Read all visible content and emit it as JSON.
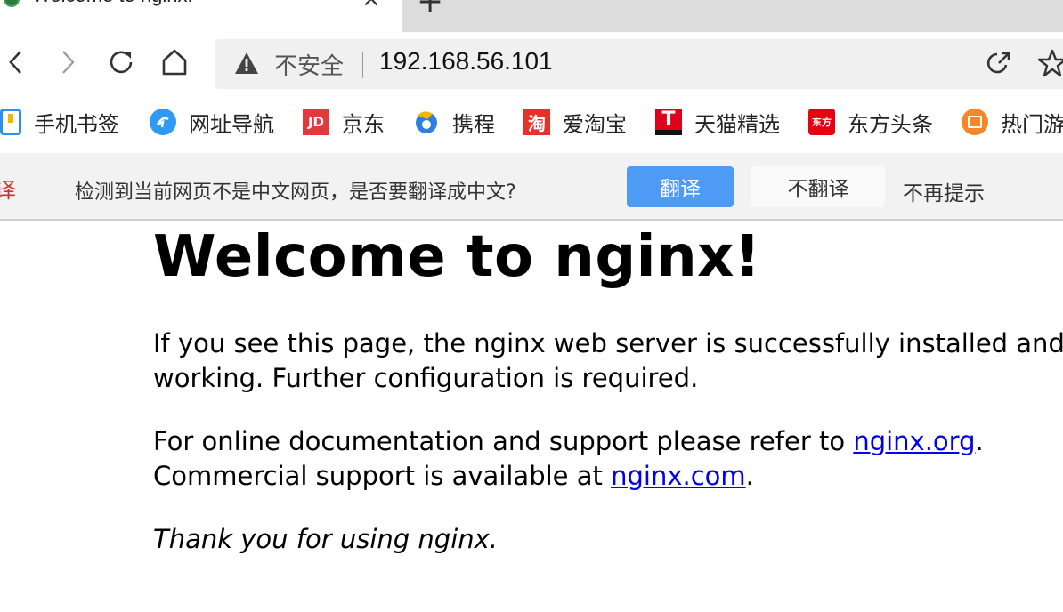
{
  "tab": {
    "title": "Welcome to nginx!",
    "close_icon": "×",
    "new_tab_icon": "+"
  },
  "address_bar": {
    "security_label": "不安全",
    "url": "192.168.56.101"
  },
  "bookmarks": [
    {
      "label": "手机书签",
      "icon": "phone-icon",
      "color": "#2f8ff0"
    },
    {
      "label": "网址导航",
      "icon": "navigation-icon",
      "color": "#2f9af5"
    },
    {
      "label": "京东",
      "icon": "jd-icon",
      "icon_text": "JD",
      "color": "#e4393c"
    },
    {
      "label": "携程",
      "icon": "ctrip-icon",
      "color": "#2a7fe0"
    },
    {
      "label": "爱淘宝",
      "icon": "taobao-icon",
      "icon_text": "淘",
      "color": "#e8302a"
    },
    {
      "label": "天猫精选",
      "icon": "tmall-icon",
      "icon_text": "T",
      "color": "#e0001a"
    },
    {
      "label": "东方头条",
      "icon": "dongfang-icon",
      "icon_text": "东方",
      "color": "#e60012"
    },
    {
      "label": "热门游",
      "icon": "games-icon",
      "color": "#f5862a"
    }
  ],
  "translate_bar": {
    "left_glyph": "译",
    "message": "检测到当前网页不是中文网页，是否要翻译成中文?",
    "translate_button": "翻译",
    "no_translate_button": "不翻译",
    "never_button": "不再提示"
  },
  "page": {
    "heading": "Welcome to nginx!",
    "p1_line1": "If you see this page, the nginx web server is successfully installed and",
    "p1_line2": "working. Further configuration is required.",
    "p2_line1_prefix": "For online documentation and support please refer to ",
    "p2_link1": "nginx.org",
    "p2_line1_suffix": ".",
    "p2_line2_prefix": "Commercial support is available at ",
    "p2_link2": "nginx.com",
    "p2_line2_suffix": ".",
    "p3": "Thank you for using nginx."
  }
}
